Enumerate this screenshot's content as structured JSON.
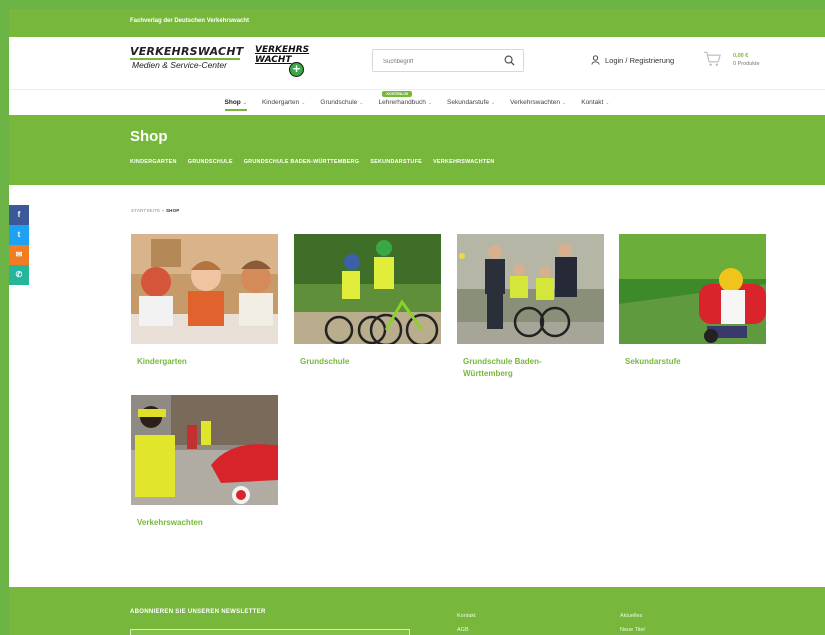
{
  "topbar": {
    "text": "Fachverlag der Deutschen Verkehrswacht"
  },
  "header": {
    "logo1_line1": "VERKEHRSWACHT",
    "logo1_line2": "Medien & Service-Center",
    "logo2_line1": "VERKEHRS",
    "logo2_line2": "WACHT",
    "search_placeholder": "Suchbegriff",
    "login_label": "Login / Registrierung",
    "cart_price": "0,00 €",
    "cart_count": "0 Produkte"
  },
  "nav": {
    "items": [
      {
        "label": "Shop",
        "active": true
      },
      {
        "label": "Kindergarten"
      },
      {
        "label": "Grundschule"
      },
      {
        "label": "Lehrerhandbuch",
        "badge": "KOSTENLOS"
      },
      {
        "label": "Sekundarstufe"
      },
      {
        "label": "Verkehrswachten"
      },
      {
        "label": "Kontakt"
      }
    ]
  },
  "hero": {
    "title": "Shop",
    "categories": [
      "KINDERGARTEN",
      "GRUNDSCHULE",
      "GRUNDSCHULE BADEN-WÜRTTEMBERG",
      "SEKUNDARSTUFE",
      "VERKEHRSWACHTEN"
    ]
  },
  "social": [
    {
      "icon": "facebook-icon",
      "glyph": "f",
      "color": "#3b5998"
    },
    {
      "icon": "twitter-icon",
      "glyph": "t",
      "color": "#1da1f2"
    },
    {
      "icon": "email-icon",
      "glyph": "✉",
      "color": "#f07d24"
    },
    {
      "icon": "whatsapp-icon",
      "glyph": "✆",
      "color": "#25b59a"
    }
  ],
  "breadcrumb": {
    "start": "STARTSEITE",
    "sep": "»",
    "current": "SHOP"
  },
  "products": [
    {
      "name": "Kindergarten"
    },
    {
      "name": "Grundschule"
    },
    {
      "name": "Grundschule Baden-Württemberg"
    },
    {
      "name": "Sekundarstufe"
    },
    {
      "name": "Verkehrswachten"
    }
  ],
  "footer": {
    "newsletter": "ABONNIEREN SIE UNSEREN NEWSLETTER",
    "col1_title": "Kontakt",
    "col1_item": "AGB",
    "col2_title": "Aktuelles",
    "col2_item": "Neue Titel"
  },
  "colors": {
    "accent": "#77b83c",
    "frame": "#6bb344"
  }
}
